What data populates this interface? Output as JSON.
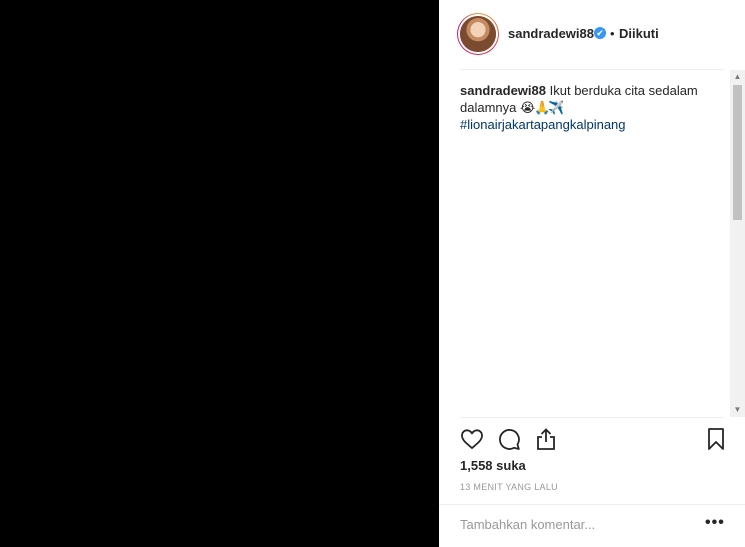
{
  "post": {
    "username": "sandradewi88",
    "verified_mark": "✔",
    "separator": "•",
    "follow_status": "Diikuti"
  },
  "caption": {
    "username": "sandradewi88",
    "text": "Ikut berduka cita sedalam dalamnya",
    "emojis": [
      "😭",
      "🙏",
      "✈️"
    ],
    "hashtag": "#lionairjakartapangkalpinang"
  },
  "stats": {
    "likes": "1,558 suka",
    "time": "13 MENIT YANG LALU"
  },
  "comment_box": {
    "placeholder": "Tambahkan komentar...",
    "more": "•••"
  },
  "icons": [
    "heart-icon",
    "comment-bubble-icon",
    "share-icon",
    "bookmark-icon"
  ],
  "colors": {
    "media_bg": "#000000",
    "verified": "#3897f0",
    "hashtag": "#003569",
    "muted": "#999999"
  }
}
